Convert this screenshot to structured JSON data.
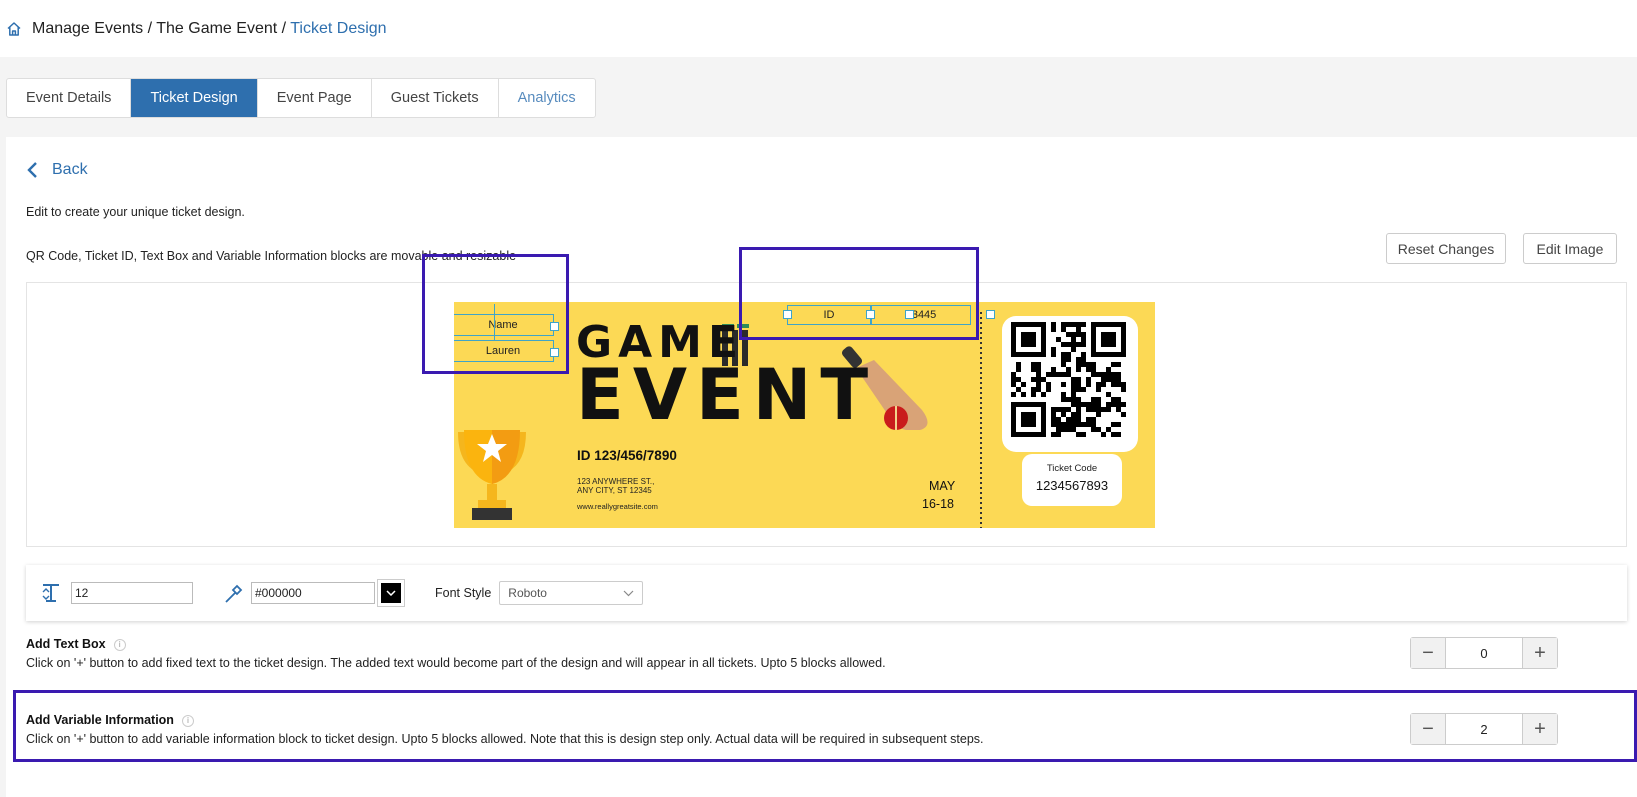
{
  "breadcrumb": {
    "part1": "Manage Events",
    "sep1": " / ",
    "part2": "The Game Event",
    "sep2": " / ",
    "current": "Ticket Design"
  },
  "tabs": [
    {
      "label": "Event Details"
    },
    {
      "label": "Ticket Design"
    },
    {
      "label": "Event Page"
    },
    {
      "label": "Guest Tickets"
    },
    {
      "label": "Analytics"
    }
  ],
  "back_label": "Back",
  "intro_text": "Edit to create your unique ticket design.",
  "movable_text": "QR Code, Ticket ID, Text Box and Variable Information blocks are movable and resizable",
  "buttons": {
    "reset": "Reset Changes",
    "edit_image": "Edit Image"
  },
  "ticket": {
    "name_label": "Name",
    "name_value": "Lauren",
    "id_label": "ID",
    "id_value": "23445",
    "title_line1": "GAME",
    "title_line2": "EVENT",
    "event_id": "ID 123/456/7890",
    "address_line1": "123 ANYWHERE ST.,",
    "address_line2": "ANY CITY, ST 12345",
    "website": "www.reallygreatsite.com",
    "month": "MAY",
    "dates": "16-18",
    "ticket_code_label": "Ticket Code",
    "ticket_code_value": "1234567893"
  },
  "toolbar": {
    "font_size": "12",
    "color_value": "#000000",
    "font_style_label": "Font Style",
    "font_style_value": "Roboto"
  },
  "add_text_box": {
    "title": "Add Text Box",
    "description": "Click on '+' button to add fixed text to the ticket design. The added text would become part of the design and will appear in all tickets. Upto 5 blocks allowed.",
    "count": "0"
  },
  "add_variable_info": {
    "title": "Add Variable Information",
    "description": "Click on '+' button to add variable information block to ticket design. Upto 5 blocks allowed. Note that this is design step only. Actual data will be required in subsequent steps.",
    "count": "2"
  },
  "colors": {
    "accent": "#2e6fae",
    "ticket_bg": "#fcd955",
    "highlight": "#3a1ab0"
  }
}
